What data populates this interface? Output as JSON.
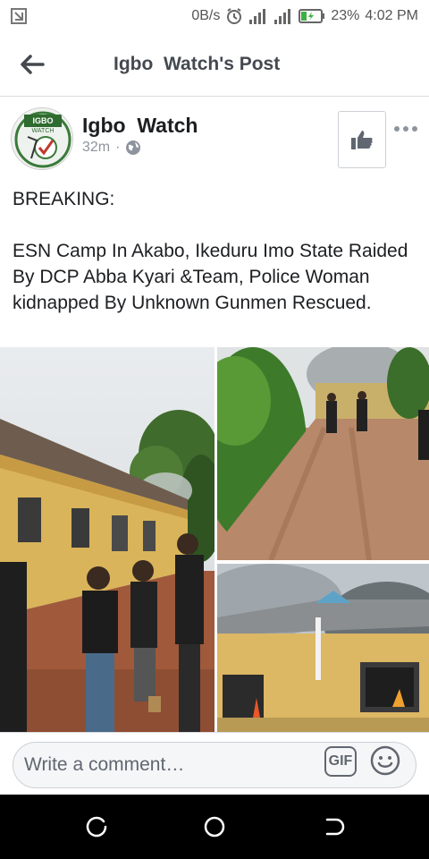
{
  "status_bar": {
    "network_speed": "0B/s",
    "battery": "23%",
    "time": "4:02 PM"
  },
  "header": {
    "title": "Igbo  Watch's Post"
  },
  "post": {
    "author": "Igbo  Watch",
    "avatar_text": "IGBO WATCH",
    "time_ago": "32m",
    "separator": "·",
    "body_heading": "BREAKING:",
    "body_text": "ESN Camp In Akabo, Ikeduru Imo State Raided By DCP Abba Kyari &Team, Police Woman kidnapped By Unknown Gunmen Rescued."
  },
  "comment_bar": {
    "placeholder": "Write a comment…",
    "gif_label": "GIF"
  },
  "colors": {
    "header_text": "#444950",
    "meta_gray": "#8d949e",
    "border": "#dadde1"
  },
  "icons": {
    "back": "arrow-left-icon",
    "like": "thumbs-up-icon",
    "more": "more-horizontal-icon",
    "privacy": "globe-icon",
    "emoji": "smiley-icon"
  }
}
